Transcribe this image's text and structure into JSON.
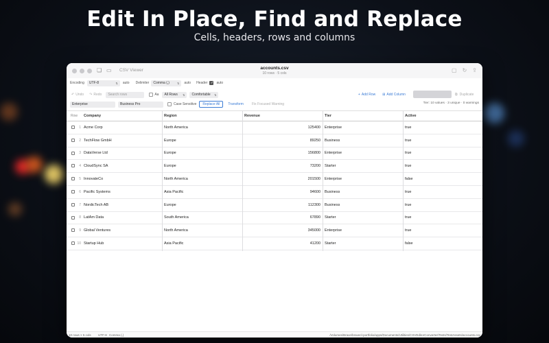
{
  "hero": {
    "title": "Edit In Place, Find and Replace",
    "subtitle": "Cells, headers, rows and columns"
  },
  "window": {
    "app_name": "CSV Viewer",
    "doc_title": "accounts.csv",
    "doc_meta": "10 rows · 5 cols"
  },
  "toolbar": {
    "encoding_label": "Encoding",
    "encoding_value": "UTF-8",
    "encoding_auto": "auto",
    "delimiter_label": "Delimiter",
    "delimiter_value": "Comma (,)",
    "delimiter_auto": "auto",
    "header_label": "Header",
    "header_auto": "auto",
    "undo_label": "Undo",
    "redo_label": "Redo",
    "search_placeholder": "Search rows",
    "aa_label": "Aa",
    "scope_value": "All Rows",
    "density_value": "Comfortable",
    "add_row_label": "Add Row",
    "add_column_label": "Add Column",
    "duplicate_label": "Duplicate"
  },
  "find_replace": {
    "find_value": "Enterprise",
    "replace_value": "Business Pro",
    "case_sensitive_label": "Case Sensitive",
    "replace_all_label": "Replace All",
    "transform_label": "Transform",
    "fix_warning_label": "Fix Focused Warning",
    "stats": "Tier: 10 values · 3 unique · 0 warnings"
  },
  "table": {
    "row_header": "Row",
    "columns": [
      "Company",
      "Region",
      "Revenue",
      "Tier",
      "Active"
    ],
    "rows": [
      [
        "1",
        "Acme Corp",
        "North America",
        "125400",
        "Enterprise",
        "true"
      ],
      [
        "2",
        "TechFlow GmbH",
        "Europe",
        "89250",
        "Business",
        "true"
      ],
      [
        "3",
        "DataVerse Ltd",
        "Europe",
        "156800",
        "Enterprise",
        "true"
      ],
      [
        "4",
        "CloudSync SA",
        "Europe",
        "73200",
        "Starter",
        "true"
      ],
      [
        "5",
        "InnovateCo",
        "North America",
        "201500",
        "Enterprise",
        "false"
      ],
      [
        "6",
        "Pacific Systems",
        "Asia Pacific",
        "94600",
        "Business",
        "true"
      ],
      [
        "7",
        "NordicTech AB",
        "Europe",
        "112300",
        "Business",
        "true"
      ],
      [
        "8",
        "LatAm Data",
        "South America",
        "67890",
        "Starter",
        "true"
      ],
      [
        "9",
        "Global Ventures",
        "North America",
        "345000",
        "Enterprise",
        "true"
      ],
      [
        "10",
        "Startup Hub",
        "Asia Pacific",
        "41200",
        "Starter",
        "false"
      ]
    ]
  },
  "status": {
    "dimensions": "10 rows × 5 cols",
    "encoding": "UTF-8",
    "delimiter": "Comma (,)",
    "path": "/Volumes/Brave/bravecl-portfolio/apps/Documents/Utilities/CSVEditorConverter/Tests/TestAssets/accounts.csv"
  },
  "colors": {
    "accent": "#3a7bd5",
    "background": "#0c1018"
  }
}
